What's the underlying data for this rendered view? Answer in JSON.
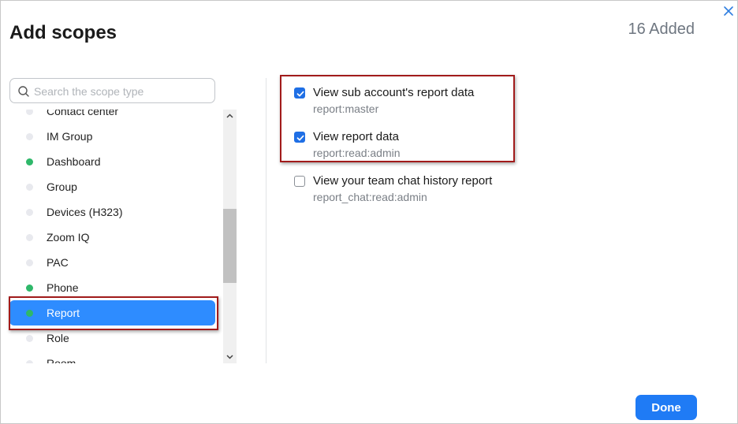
{
  "dialog": {
    "title": "Add scopes",
    "added_count": "16 Added",
    "close_label": "×"
  },
  "search": {
    "placeholder": "Search the scope type",
    "value": ""
  },
  "scope_types": [
    {
      "label": "Contact center",
      "active": false
    },
    {
      "label": "IM Group",
      "active": false
    },
    {
      "label": "Dashboard",
      "active": true
    },
    {
      "label": "Group",
      "active": false
    },
    {
      "label": "Devices (H323)",
      "active": false
    },
    {
      "label": "Zoom IQ",
      "active": false
    },
    {
      "label": "PAC",
      "active": false
    },
    {
      "label": "Phone",
      "active": true
    },
    {
      "label": "Report",
      "active": true,
      "selected": true
    },
    {
      "label": "Role",
      "active": false
    },
    {
      "label": "Room",
      "active": false
    }
  ],
  "permissions": [
    {
      "name": "View sub account's report data",
      "code": "report:master",
      "checked": true
    },
    {
      "name": "View report data",
      "code": "report:read:admin",
      "checked": true
    },
    {
      "name": "View your team chat history report",
      "code": "report_chat:read:admin",
      "checked": false
    }
  ],
  "footer": {
    "done_label": "Done"
  },
  "colors": {
    "accent": "#2e8cff",
    "button": "#1f7bf5",
    "active_dot": "#2fb86a",
    "inactive_dot": "#e8e9ee",
    "highlight_border": "#a11b1b"
  }
}
